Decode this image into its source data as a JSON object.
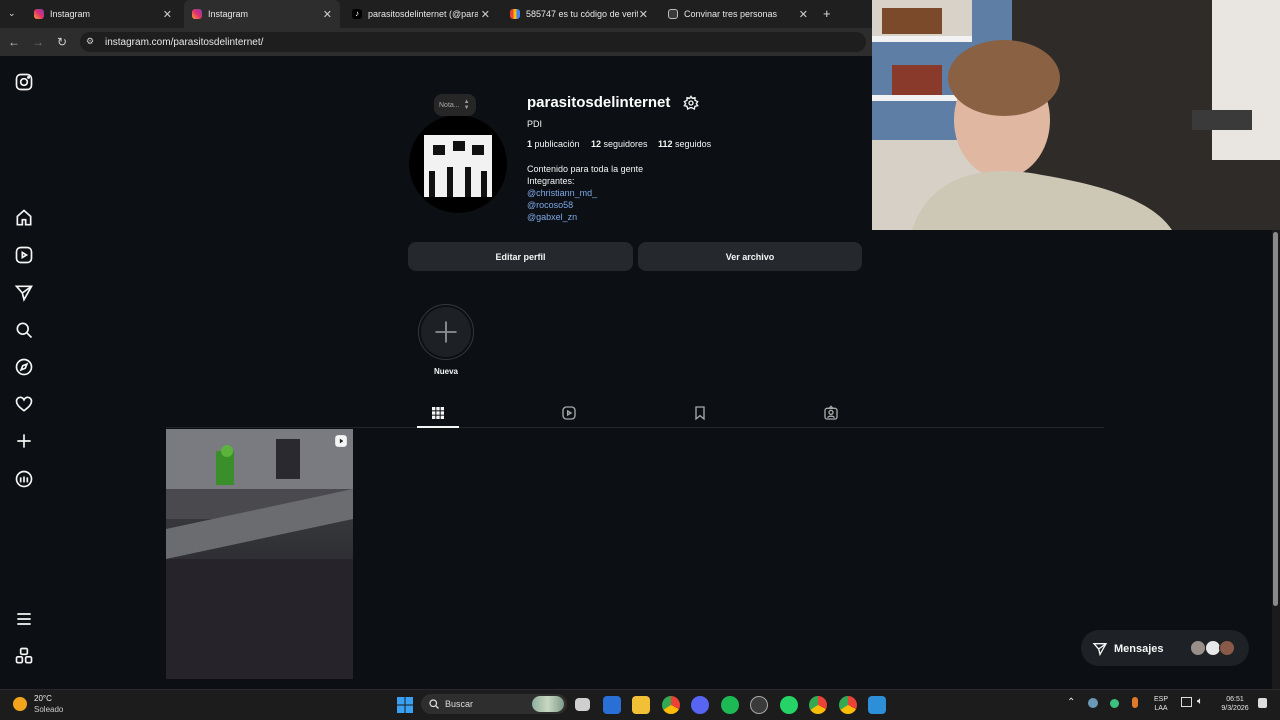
{
  "browser": {
    "tabs": [
      {
        "title": "Instagram",
        "icon": "instagram-icon",
        "active": false
      },
      {
        "title": "Instagram",
        "icon": "instagram-icon",
        "active": true
      },
      {
        "title": "parasitosdelinternet (@parasito",
        "icon": "tiktok-icon",
        "active": false
      },
      {
        "title": "585747 es tu código de verifica",
        "icon": "gmail-icon",
        "active": false
      },
      {
        "title": "Convinar tres personas",
        "icon": "copilot-icon",
        "active": false
      }
    ],
    "url": "instagram.com/parasitosdelinternet/"
  },
  "profile": {
    "username": "parasitosdelinternet",
    "note_placeholder": "Nota...",
    "name": "PDI",
    "posts_count": "1",
    "posts_label": "publicación",
    "followers_count": "12",
    "followers_label": "seguidores",
    "following_count": "112",
    "following_label": "seguidos",
    "bio_line1": "Contenido para toda la gente",
    "bio_line2": "Integrantes:",
    "mentions": [
      "@christiann_md_",
      "@rocoso58",
      "@gabxel_zn"
    ],
    "edit_button": "Editar perfil",
    "archive_button": "Ver archivo",
    "new_highlight": "Nueva"
  },
  "messages": {
    "label": "Mensajes"
  },
  "taskbar": {
    "weather_temp": "20°C",
    "weather_desc": "Soleado",
    "search_label": "Buscar",
    "lang_top": "ESP",
    "lang_bottom": "LAA",
    "time": "06:51",
    "date": "9/3/2026"
  },
  "colors": {
    "background": "#0c1014",
    "link": "#7fa7e6",
    "button": "#25292e"
  }
}
